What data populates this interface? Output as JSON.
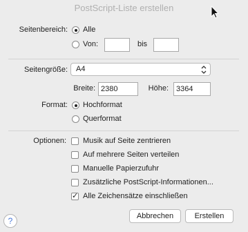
{
  "window": {
    "title": "PostScript-Liste erstellen"
  },
  "pages": {
    "label": "Seitenbereich:",
    "option_all": "Alle",
    "option_from": "Von:",
    "from_value": "",
    "to_label": "bis",
    "to_value": "",
    "selected": "all"
  },
  "page_size": {
    "label": "Seitengröße:",
    "value": "A4",
    "width_label": "Breite:",
    "width_value": "2380",
    "height_label": "Höhe:",
    "height_value": "3364"
  },
  "format": {
    "label": "Format:",
    "portrait": "Hochformat",
    "landscape": "Querformat",
    "selected": "portrait"
  },
  "options": {
    "label": "Optionen:",
    "items": [
      {
        "label": "Musik auf Seite zentrieren",
        "checked": false
      },
      {
        "label": "Auf mehrere Seiten verteilen",
        "checked": false
      },
      {
        "label": "Manuelle Papierzufuhr",
        "checked": false
      },
      {
        "label": "Zusätzliche PostScript-Informationen...",
        "checked": false
      },
      {
        "label": "Alle Zeichensätze einschließen",
        "checked": true
      }
    ]
  },
  "buttons": {
    "cancel": "Abbrechen",
    "create": "Erstellen",
    "help": "?"
  },
  "icons": {
    "cursor": "arrow-cursor-icon",
    "select": "updown-chevron-icon"
  }
}
